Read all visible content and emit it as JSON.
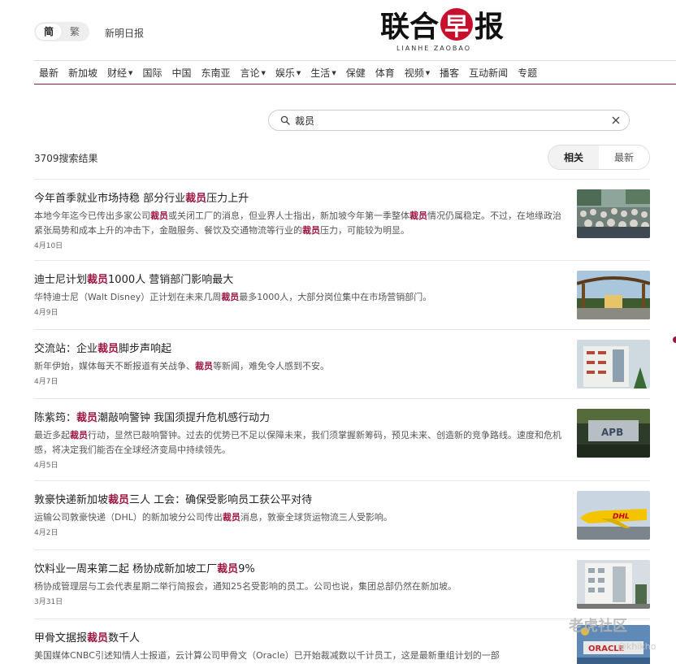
{
  "header": {
    "lang": {
      "simplified": "简",
      "traditional": "繁"
    },
    "sister_site": "新明日报",
    "logo": {
      "cn_pre": "联合",
      "cn_zao": "早",
      "cn_post": "报",
      "en": "LIANHE ZAOBAO"
    }
  },
  "nav": [
    {
      "label": "最新",
      "dropdown": false
    },
    {
      "label": "新加坡",
      "dropdown": false
    },
    {
      "label": "财经",
      "dropdown": true
    },
    {
      "label": "国际",
      "dropdown": false
    },
    {
      "label": "中国",
      "dropdown": false
    },
    {
      "label": "东南亚",
      "dropdown": false
    },
    {
      "label": "言论",
      "dropdown": true
    },
    {
      "label": "娱乐",
      "dropdown": true
    },
    {
      "label": "生活",
      "dropdown": true
    },
    {
      "label": "保健",
      "dropdown": false
    },
    {
      "label": "体育",
      "dropdown": false
    },
    {
      "label": "视频",
      "dropdown": true
    },
    {
      "label": "播客",
      "dropdown": false
    },
    {
      "label": "互动新闻",
      "dropdown": false
    },
    {
      "label": "专题",
      "dropdown": false
    }
  ],
  "search": {
    "query": "裁员"
  },
  "results": {
    "count_text": "3709搜索结果",
    "sort": {
      "relevant": "相关",
      "latest": "最新",
      "active": "relevant"
    }
  },
  "articles": [
    {
      "title": [
        "今年首季就业市场持稳 部分行业",
        {
          "hl": "裁员"
        },
        "压力上升"
      ],
      "summary": [
        "本地今年迄今已传出多家公司",
        {
          "hl": "裁员"
        },
        "或关闭工厂的消息，但业界人士指出，新加坡今年第一季整体",
        {
          "hl": "裁员"
        },
        "情况仍属稳定。不过，在地缘政治紧张局势和成本上升的冲击下，金融服务、餐饮及交通物流等行业的",
        {
          "hl": "裁员"
        },
        "压力，可能较为明显。"
      ],
      "date": "4月10日",
      "thumb": "crowd-photo"
    },
    {
      "title": [
        "迪士尼计划",
        {
          "hl": "裁员"
        },
        "1000人 营销部门影响最大"
      ],
      "summary": [
        "华特迪士尼（Walt Disney）正计划在未来几周",
        {
          "hl": "裁员"
        },
        "最多1000人，大部分岗位集中在市场营销部门。"
      ],
      "date": "4月9日",
      "thumb": "disney-gate-photo"
    },
    {
      "title": [
        "交流站：企业",
        {
          "hl": "裁员"
        },
        "脚步声响起"
      ],
      "summary": [
        "新年伊始，媒体每天不断报道有关战争、",
        {
          "hl": "裁员"
        },
        "等新闻，难免令人感到不安。"
      ],
      "date": "4月7日",
      "thumb": "office-building-photo"
    },
    {
      "title": [
        "陈紫筠：",
        {
          "hl": "裁员"
        },
        "潮敲响警钟 我国须提升危机感行动力"
      ],
      "summary": [
        "最近多起",
        {
          "hl": "裁员"
        },
        "行动，显然已敲响警钟。过去的优势已不足以保障未来，我们须掌握新筹码，预见未来、创造新的竞争路线。速度和危机感，将决定我们能否在全球经济变局中持续领先。"
      ],
      "date": "4月5日",
      "thumb": "apb-sign-photo"
    },
    {
      "title": [
        "敦豪快递新加坡",
        {
          "hl": "裁员"
        },
        "三人 工会：确保受影响员工获公平对待"
      ],
      "summary": [
        "运输公司敦豪快递（DHL）的新加坡分公司传出",
        {
          "hl": "裁员"
        },
        "消息，敦豪全球货运物流三人受影响。"
      ],
      "date": "4月2日",
      "thumb": "dhl-plane-photo"
    },
    {
      "title": [
        "饮料业一周来第二起 杨协成新加坡工厂",
        {
          "hl": "裁员"
        },
        "9%"
      ],
      "summary": [
        "杨协成管理层与工会代表星期二举行简报会，通知25名受影响的员工。公司也说，集团总部仍然在新加坡。"
      ],
      "date": "3月31日",
      "thumb": "factory-building-photo"
    },
    {
      "title": [
        "甲骨文据报",
        {
          "hl": "裁员"
        },
        "数千人"
      ],
      "summary": [
        "美国媒体CNBC引述知情人士报道，云计算公司甲骨文（Oracle）已开始裁减数以千计员工，这是最新重组计划的一部"
      ],
      "date": "",
      "thumb": "oracle-sign-photo"
    }
  ],
  "watermark": {
    "text": "老虎社区",
    "handle": "@khikho"
  },
  "colors": {
    "accent": "#9b1540",
    "logo_red": "#c8102e"
  }
}
